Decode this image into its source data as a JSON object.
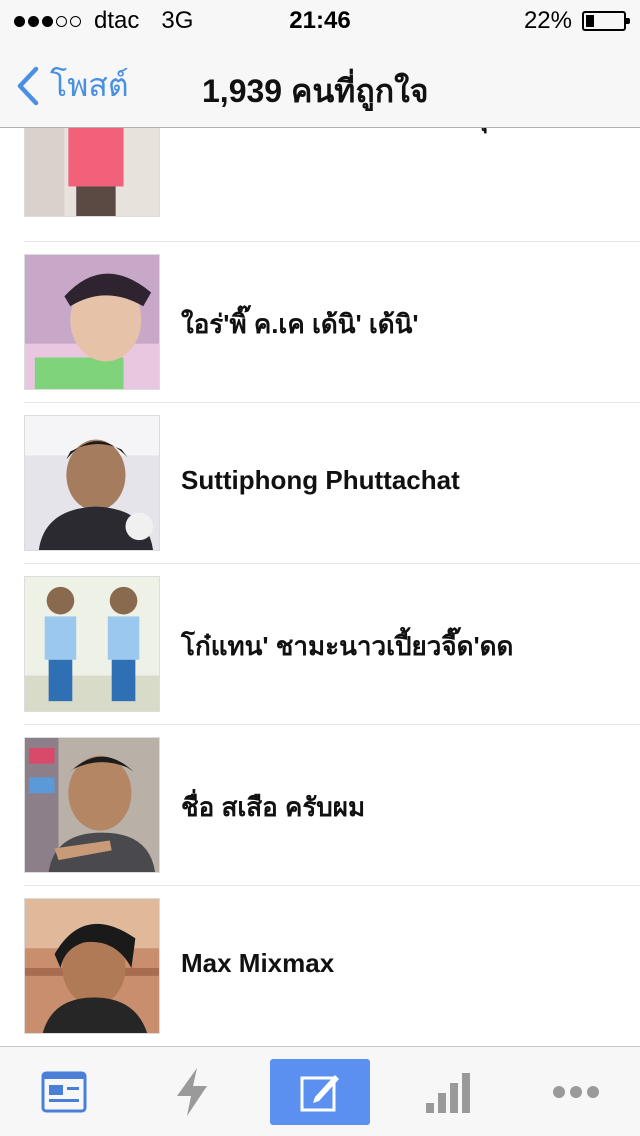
{
  "status_bar": {
    "carrier": "dtac",
    "network": "3G",
    "time": "21:46",
    "battery": "22%",
    "battery_level": 0.22
  },
  "nav": {
    "back_label": "โพสต์",
    "title": "1,939 คนที่ถูกใจ"
  },
  "people": [
    {
      "name": "บ่าวแมน ทีมงานใบไม้เมา สุขเกษม"
    },
    {
      "name": "ใอร่'พิ๊ ค.เค เด้นิ' เด้นิ'"
    },
    {
      "name": "Suttiphong Phuttachat"
    },
    {
      "name": "โก๋แทน' ชามะนาวเปี้ยวจี๊ด'ดด"
    },
    {
      "name": "ชื่อ สเสือ ครับผม"
    },
    {
      "name": "Max Mixmax"
    }
  ],
  "tab_bar": {
    "tabs": [
      {
        "icon": "news-feed-icon",
        "active": false
      },
      {
        "icon": "lightning-icon",
        "active": false
      },
      {
        "icon": "compose-icon",
        "active": true
      },
      {
        "icon": "signal-bars-icon",
        "active": false
      },
      {
        "icon": "more-icon",
        "active": false
      }
    ]
  },
  "colors": {
    "accent": "#4a90e2",
    "active_tab": "#5b8ff0"
  }
}
